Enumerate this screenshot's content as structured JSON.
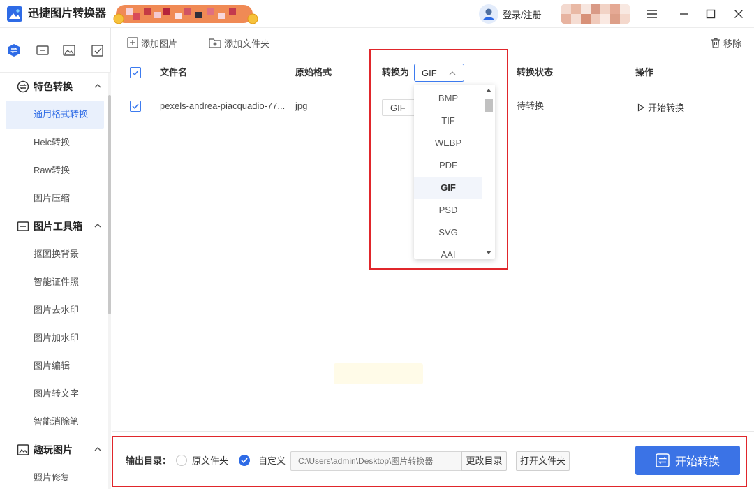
{
  "app": {
    "title": "迅捷图片转换器",
    "login_label": "登录/注册",
    "colors": {
      "accent": "#3b73e6",
      "highlight": "#e0262b",
      "active_bg": "#e9f0fc"
    }
  },
  "sidebar": {
    "icon_tabs": [
      "convert-icon",
      "toolbox-icon",
      "image-icon",
      "check-square-icon"
    ],
    "groups": [
      {
        "label": "特色转换",
        "icon": "convert-icon",
        "items": [
          "通用格式转换",
          "Heic转换",
          "Raw转换",
          "图片压缩"
        ]
      },
      {
        "label": "图片工具箱",
        "icon": "toolbox-icon",
        "items": [
          "抠图换背景",
          "智能证件照",
          "图片去水印",
          "图片加水印",
          "图片编辑",
          "图片转文字",
          "智能消除笔"
        ]
      },
      {
        "label": "趣玩图片",
        "icon": "image-icon",
        "items": [
          "照片修复"
        ]
      }
    ],
    "active_item": "通用格式转换"
  },
  "toolbar": {
    "add_image": "添加图片",
    "add_folder": "添加文件夹",
    "remove": "移除"
  },
  "table": {
    "headers": {
      "filename": "文件名",
      "orig_format": "原始格式",
      "convert_to": "转换为",
      "status": "转换状态",
      "action": "操作"
    },
    "global_format": "GIF",
    "rows": [
      {
        "filename": "pexels-andrea-piacquadio-77...",
        "orig_format": "jpg",
        "target": "GIF",
        "status": "待转换",
        "action": "开始转换"
      }
    ]
  },
  "dropdown": {
    "options": [
      "BMP",
      "TIF",
      "WEBP",
      "PDF",
      "GIF",
      "PSD",
      "SVG",
      "AAI"
    ],
    "selected": "GIF"
  },
  "footer": {
    "output_label": "输出目录：",
    "option_original": "原文件夹",
    "option_custom": "自定义",
    "path_placeholder": "C:\\Users\\admin\\Desktop\\图片转换器",
    "change_dir": "更改目录",
    "open_folder": "打开文件夹",
    "start": "开始转换"
  }
}
